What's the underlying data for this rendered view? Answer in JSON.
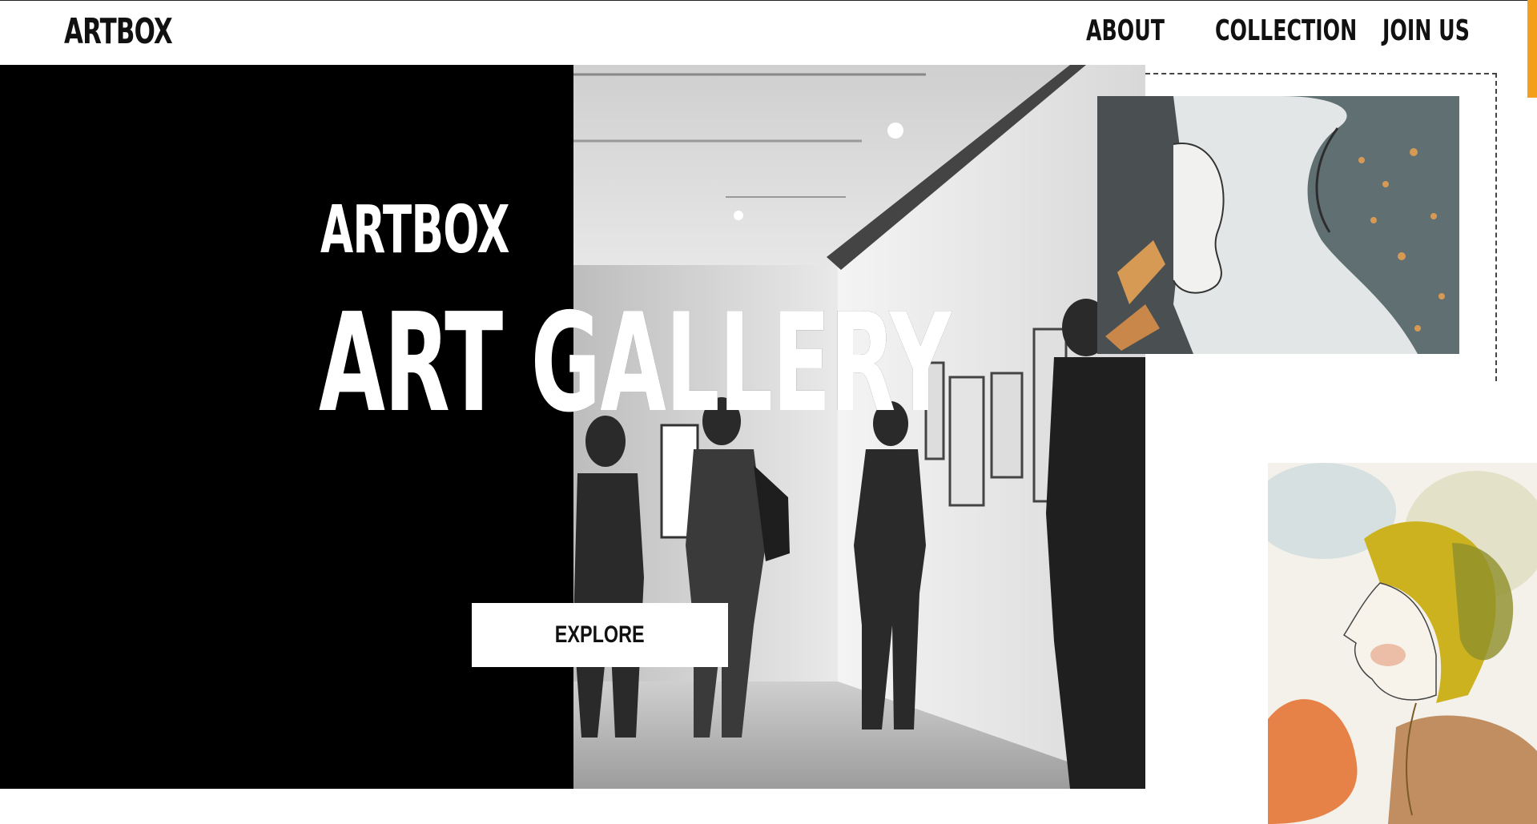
{
  "header": {
    "logo": "ARTBOX",
    "nav": [
      {
        "label": "ABOUT"
      },
      {
        "label": "COLLECTION"
      },
      {
        "label": "JOIN US"
      }
    ]
  },
  "hero": {
    "subtitle": "ARTBOX",
    "title": "ART GALLERY",
    "button_label": "EXPLORE"
  },
  "colors": {
    "accent": "#f2a01c",
    "panel": "#000000",
    "background": "#ffffff"
  },
  "images": {
    "photo": "gallery-visitors-photo",
    "artwork_top": "watercolor-woman-and-leopard",
    "artwork_bottom": "watercolor-woman-portrait"
  }
}
